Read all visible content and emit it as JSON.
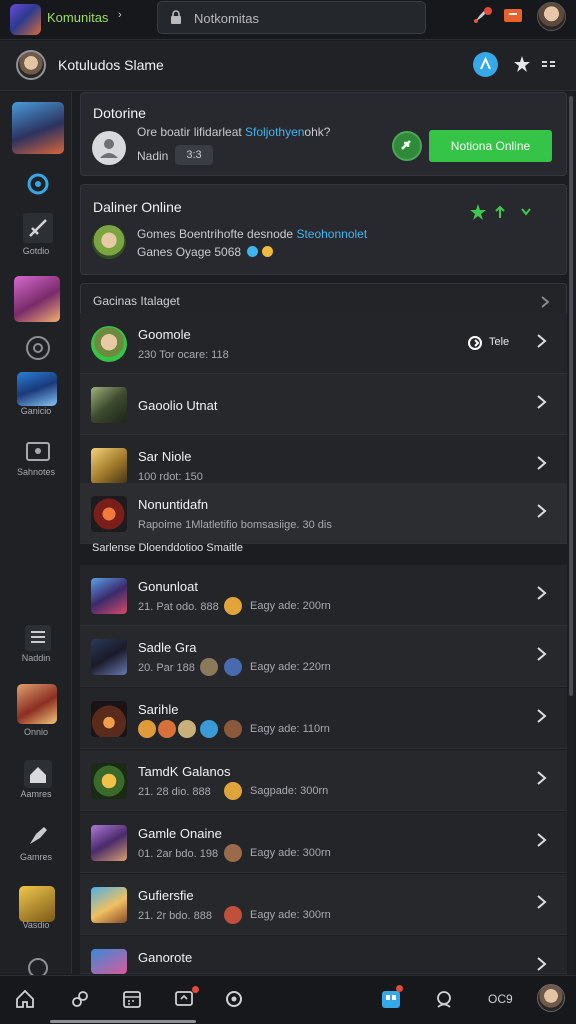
{
  "topbar": {
    "app_title": "Komunitas",
    "search_text": "Notkomitas",
    "colors": {
      "accent_green": "#35c348",
      "link_blue": "#3fb6f2"
    }
  },
  "profilebar": {
    "name": "Kotuludos Slame"
  },
  "rail": {
    "labels": [
      "Gotdio",
      "Ganicio",
      "Sahnotes",
      "Naddin",
      "Onnio",
      "Aamres",
      "Gamres",
      "Vasdio"
    ]
  },
  "card1": {
    "title": "Dotorine",
    "text_prefix": "Ore boatir lifidarleat ",
    "text_link": "Sfoljothyen",
    "text_suffix": "ohk?",
    "label": "Nadin",
    "pill": "3:3",
    "button_label": "Notiona Online"
  },
  "card2": {
    "title": "Daliner Online",
    "line1_prefix": "Gomes Boentrihofte desnode ",
    "line1_link": "Steohonnolet",
    "line2": "Ganes Oyage 5068"
  },
  "list1": {
    "header": "Gacinas Italaget",
    "rows": [
      {
        "name": "Goomole",
        "sub": "230 Tor ocare: 118",
        "action": "Tele"
      },
      {
        "name": "Gaoolio Utnat",
        "sub": ""
      },
      {
        "name": "Sar Niole",
        "sub": "100 rdot: 150"
      },
      {
        "name": "Nonuntidafn",
        "sub": "Rapoime 1Mlatletifio bomsasiige. 30 dis"
      }
    ]
  },
  "list2": {
    "header": "Sarlense Dloenddotioo Smaitle",
    "rows": [
      {
        "name": "Gonunloat",
        "sub": "21. Pat odo. 888",
        "time": "Eagy ade: 200rn"
      },
      {
        "name": "Sadle Gra",
        "sub": "20. Par 188",
        "time": "Eagy ade: 220rn"
      },
      {
        "name": "Sarihle",
        "sub": "",
        "time": "Eagy ade: 110rn"
      },
      {
        "name": "TamdK Galanos",
        "sub": "21. 28 dio. 888",
        "time": "Sagpade: 300rn"
      },
      {
        "name": "Gamle Onaine",
        "sub": "01. 2ar bdo. 198",
        "time": "Eagy ade: 300rn"
      },
      {
        "name": "Gufiersfie",
        "sub": "21. 2r bdo. 888",
        "time": "Eagy ade: 300rn"
      },
      {
        "name": "Ganorote",
        "sub": "",
        "time": ""
      }
    ]
  },
  "bottombar": {
    "text": "OC9"
  }
}
